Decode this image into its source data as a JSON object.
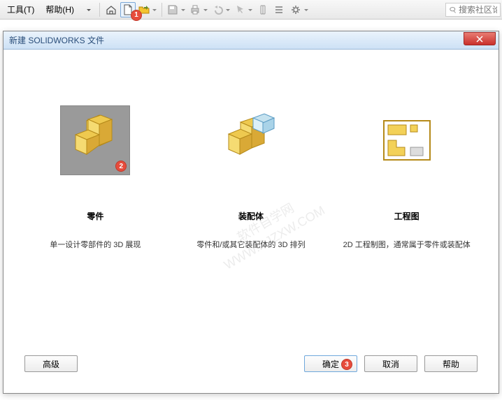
{
  "menu": {
    "tools": "工具(T)",
    "help": "帮助(H)"
  },
  "search": {
    "placeholder": "搜索社区论"
  },
  "badges": {
    "b1": "1",
    "b2": "2",
    "b3": "3"
  },
  "dialog": {
    "title": "新建 SOLIDWORKS 文件",
    "options": [
      {
        "title": "零件",
        "desc": "单一设计零部件的 3D 展现"
      },
      {
        "title": "装配体",
        "desc": "零件和/或其它装配体的 3D 排列"
      },
      {
        "title": "工程图",
        "desc": "2D 工程制图，通常属于零件或装配体"
      }
    ],
    "buttons": {
      "advanced": "高级",
      "ok": "确定",
      "cancel": "取消",
      "help": "帮助"
    }
  },
  "watermark": "软件自学网\nWWW.RJZXW.COM"
}
